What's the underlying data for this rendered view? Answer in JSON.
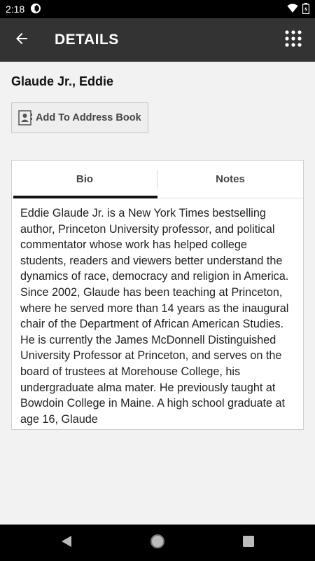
{
  "status_bar": {
    "time": "2:18",
    "icons": [
      "notification-icon",
      "wifi-icon",
      "battery-icon"
    ]
  },
  "app_bar": {
    "title": "DETAILS",
    "back_icon": "arrow-left-icon",
    "menu_icon": "grid-menu-icon",
    "background": "#333333"
  },
  "contact": {
    "name": "Glaude Jr., Eddie",
    "add_button_label": "Add To Address Book",
    "add_button_icon": "contact-card-icon"
  },
  "tabs": [
    {
      "label": "Bio",
      "active": true
    },
    {
      "label": "Notes",
      "active": false
    }
  ],
  "bio": {
    "text": "Eddie Glaude Jr. is a New York Times bestselling author, Princeton University professor, and political commentator whose work has helped college students, readers and viewers better understand the dynamics of race, democracy and religion in America. Since 2002, Glaude has been teaching at Princeton, where he served more than 14 years as the inaugural chair of the Department of African American Studies. He is currently the James McDonnell Distinguished University Professor at Princeton, and serves on the board of trustees at Morehouse College, his undergraduate alma mater. He previously taught at Bowdoin College in Maine. A high school graduate at age 16, Glaude"
  },
  "nav_bar": {
    "icons": [
      "back-triangle-icon",
      "home-circle-icon",
      "recents-square-icon"
    ]
  }
}
